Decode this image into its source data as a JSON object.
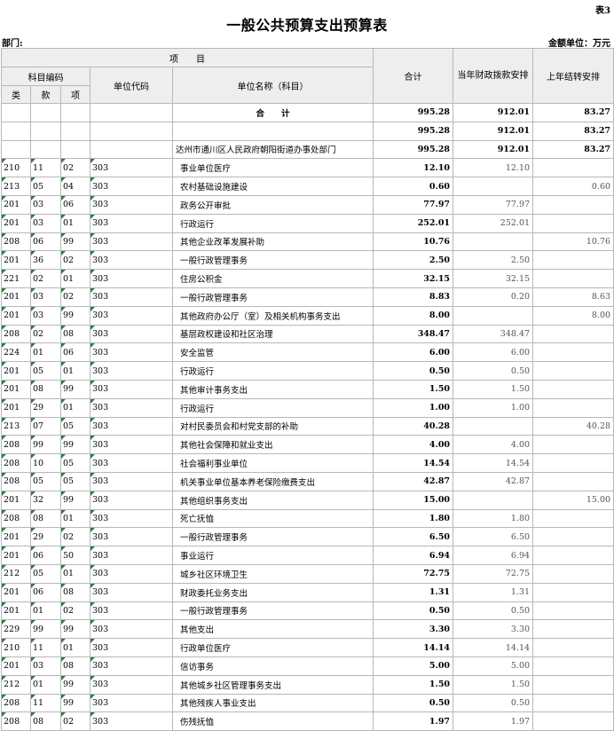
{
  "header": {
    "tag": "表3",
    "title": "一般公共预算支出预算表",
    "dept_label": "部门:",
    "unit_label": "金额单位：万元"
  },
  "columns": {
    "project": "项　　目",
    "subject_code": "科目编码",
    "lei": "类",
    "kuan": "款",
    "xiang": "项",
    "unit_code": "单位代码",
    "unit_name": "单位名称（科目）",
    "total": "合计",
    "current": "当年财政拨款安排",
    "prior": "上年结转安排"
  },
  "summary": {
    "label": "合　　计",
    "total": "995.28",
    "current": "912.01",
    "prior": "83.27"
  },
  "subtotal": {
    "total": "995.28",
    "current": "912.01",
    "prior": "83.27"
  },
  "unit_row": {
    "name": "达州市通川区人民政府朝阳街道办事处部门",
    "total": "995.28",
    "current": "912.01",
    "prior": "83.27"
  },
  "rows": [
    {
      "lei": "210",
      "kuan": "11",
      "xiang": "02",
      "code": "303",
      "name": "事业单位医疗",
      "total": "12.10",
      "current": "12.10",
      "prior": ""
    },
    {
      "lei": "213",
      "kuan": "05",
      "xiang": "04",
      "code": "303",
      "name": "农村基础设施建设",
      "total": "0.60",
      "current": "",
      "prior": "0.60"
    },
    {
      "lei": "201",
      "kuan": "03",
      "xiang": "06",
      "code": "303",
      "name": "政务公开审批",
      "total": "77.97",
      "current": "77.97",
      "prior": ""
    },
    {
      "lei": "201",
      "kuan": "03",
      "xiang": "01",
      "code": "303",
      "name": "行政运行",
      "total": "252.01",
      "current": "252.01",
      "prior": ""
    },
    {
      "lei": "208",
      "kuan": "06",
      "xiang": "99",
      "code": "303",
      "name": "其他企业改革发展补助",
      "total": "10.76",
      "current": "",
      "prior": "10.76"
    },
    {
      "lei": "201",
      "kuan": "36",
      "xiang": "02",
      "code": "303",
      "name": "一般行政管理事务",
      "total": "2.50",
      "current": "2.50",
      "prior": ""
    },
    {
      "lei": "221",
      "kuan": "02",
      "xiang": "01",
      "code": "303",
      "name": "住房公积金",
      "total": "32.15",
      "current": "32.15",
      "prior": ""
    },
    {
      "lei": "201",
      "kuan": "03",
      "xiang": "02",
      "code": "303",
      "name": "一般行政管理事务",
      "total": "8.83",
      "current": "0.20",
      "prior": "8.63"
    },
    {
      "lei": "201",
      "kuan": "03",
      "xiang": "99",
      "code": "303",
      "name": "其他政府办公厅（室）及相关机构事务支出",
      "total": "8.00",
      "current": "",
      "prior": "8.00"
    },
    {
      "lei": "208",
      "kuan": "02",
      "xiang": "08",
      "code": "303",
      "name": "基层政权建设和社区治理",
      "total": "348.47",
      "current": "348.47",
      "prior": ""
    },
    {
      "lei": "224",
      "kuan": "01",
      "xiang": "06",
      "code": "303",
      "name": "安全监管",
      "total": "6.00",
      "current": "6.00",
      "prior": ""
    },
    {
      "lei": "201",
      "kuan": "05",
      "xiang": "01",
      "code": "303",
      "name": "行政运行",
      "total": "0.50",
      "current": "0.50",
      "prior": ""
    },
    {
      "lei": "201",
      "kuan": "08",
      "xiang": "99",
      "code": "303",
      "name": "其他审计事务支出",
      "total": "1.50",
      "current": "1.50",
      "prior": ""
    },
    {
      "lei": "201",
      "kuan": "29",
      "xiang": "01",
      "code": "303",
      "name": "行政运行",
      "total": "1.00",
      "current": "1.00",
      "prior": ""
    },
    {
      "lei": "213",
      "kuan": "07",
      "xiang": "05",
      "code": "303",
      "name": "对村民委员会和村党支部的补助",
      "total": "40.28",
      "current": "",
      "prior": "40.28"
    },
    {
      "lei": "208",
      "kuan": "99",
      "xiang": "99",
      "code": "303",
      "name": "其他社会保障和就业支出",
      "total": "4.00",
      "current": "4.00",
      "prior": ""
    },
    {
      "lei": "208",
      "kuan": "10",
      "xiang": "05",
      "code": "303",
      "name": "社会福利事业单位",
      "total": "14.54",
      "current": "14.54",
      "prior": ""
    },
    {
      "lei": "208",
      "kuan": "05",
      "xiang": "05",
      "code": "303",
      "name": "机关事业单位基本养老保险缴费支出",
      "total": "42.87",
      "current": "42.87",
      "prior": ""
    },
    {
      "lei": "201",
      "kuan": "32",
      "xiang": "99",
      "code": "303",
      "name": "其他组织事务支出",
      "total": "15.00",
      "current": "",
      "prior": "15.00"
    },
    {
      "lei": "208",
      "kuan": "08",
      "xiang": "01",
      "code": "303",
      "name": "死亡抚恤",
      "total": "1.80",
      "current": "1.80",
      "prior": ""
    },
    {
      "lei": "201",
      "kuan": "29",
      "xiang": "02",
      "code": "303",
      "name": "一般行政管理事务",
      "total": "6.50",
      "current": "6.50",
      "prior": ""
    },
    {
      "lei": "201",
      "kuan": "06",
      "xiang": "50",
      "code": "303",
      "name": "事业运行",
      "total": "6.94",
      "current": "6.94",
      "prior": ""
    },
    {
      "lei": "212",
      "kuan": "05",
      "xiang": "01",
      "code": "303",
      "name": "城乡社区环境卫生",
      "total": "72.75",
      "current": "72.75",
      "prior": ""
    },
    {
      "lei": "201",
      "kuan": "06",
      "xiang": "08",
      "code": "303",
      "name": "财政委托业务支出",
      "total": "1.31",
      "current": "1.31",
      "prior": ""
    },
    {
      "lei": "201",
      "kuan": "01",
      "xiang": "02",
      "code": "303",
      "name": "一般行政管理事务",
      "total": "0.50",
      "current": "0.50",
      "prior": ""
    },
    {
      "lei": "229",
      "kuan": "99",
      "xiang": "99",
      "code": "303",
      "name": "其他支出",
      "total": "3.30",
      "current": "3.30",
      "prior": ""
    },
    {
      "lei": "210",
      "kuan": "11",
      "xiang": "01",
      "code": "303",
      "name": "行政单位医疗",
      "total": "14.14",
      "current": "14.14",
      "prior": ""
    },
    {
      "lei": "201",
      "kuan": "03",
      "xiang": "08",
      "code": "303",
      "name": "信访事务",
      "total": "5.00",
      "current": "5.00",
      "prior": ""
    },
    {
      "lei": "212",
      "kuan": "01",
      "xiang": "99",
      "code": "303",
      "name": "其他城乡社区管理事务支出",
      "total": "1.50",
      "current": "1.50",
      "prior": ""
    },
    {
      "lei": "208",
      "kuan": "11",
      "xiang": "99",
      "code": "303",
      "name": "其他残疾人事业支出",
      "total": "0.50",
      "current": "0.50",
      "prior": ""
    },
    {
      "lei": "208",
      "kuan": "08",
      "xiang": "02",
      "code": "303",
      "name": "伤残抚恤",
      "total": "1.97",
      "current": "1.97",
      "prior": ""
    }
  ]
}
